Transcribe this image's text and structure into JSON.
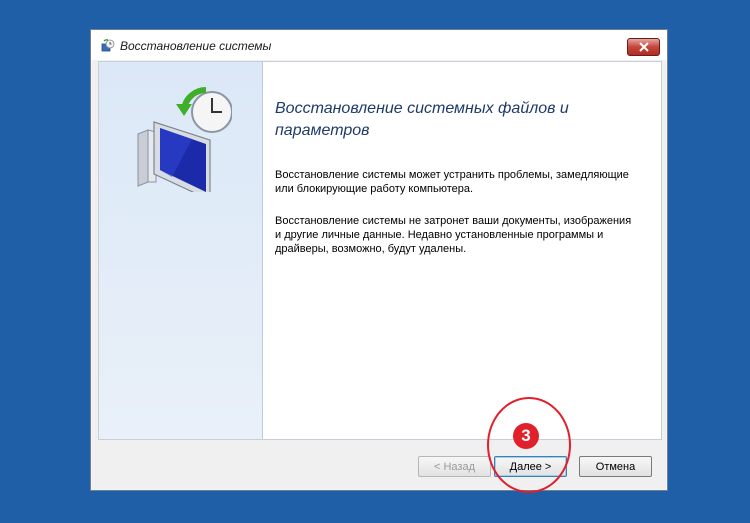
{
  "window": {
    "title": "Восстановление системы",
    "close_icon": "close-icon"
  },
  "main": {
    "heading": "Восстановление системных файлов и параметров",
    "paragraph1": "Восстановление системы может устранить проблемы, замедляющие или блокирующие работу компьютера.",
    "paragraph2": "Восстановление системы не затронет ваши документы, изображения и другие личные данные. Недавно установленные программы и драйверы, возможно, будут удалены."
  },
  "buttons": {
    "back": "< Назад",
    "next": "Далее >",
    "cancel": "Отмена"
  },
  "annotation": {
    "step_number": "3"
  },
  "colors": {
    "desktop": "#1f5fa8",
    "annotation": "#e0202a",
    "title_text": "#1e3a6a"
  }
}
